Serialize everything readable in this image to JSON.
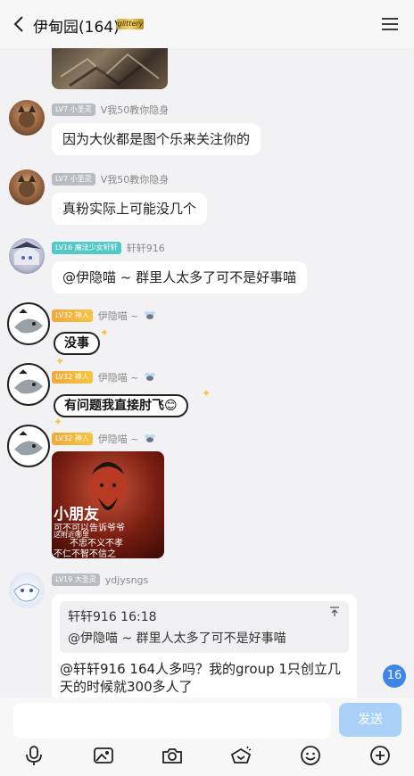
{
  "header": {
    "title": "伊甸园(164)",
    "badge": "glittery",
    "back_icon": "chevron-left-icon",
    "menu_icon": "hamburger-menu-icon"
  },
  "messages": [
    {
      "level": "LV7 小圣灵",
      "name": "V我50教你隐身",
      "text": "因为大伙都是图个乐来关注你的"
    },
    {
      "level": "LV7 小圣灵",
      "name": "V我50教你隐身",
      "text": "真粉实际上可能没几个"
    },
    {
      "level": "LV16 魔法少女轩轩",
      "name": "轩轩916",
      "text": "@伊隐喵 ~ 群里人太多了可不是好事喵"
    },
    {
      "level": "LV32 神人",
      "name": "伊隐喵 ~",
      "sticker_text": "没事"
    },
    {
      "level": "LV32 神人",
      "name": "伊隐喵 ~",
      "sticker_text": "有问题我直接肘飞😊"
    },
    {
      "level": "LV32 神人",
      "name": "伊隐喵 ~",
      "image_caption": "小朋友",
      "image_line2": "可不可以告诉爷爷",
      "image_line3": "这附近哪里",
      "image_line4": "不忠不义不孝",
      "image_line5": "不仁不智不信之"
    },
    {
      "level": "LV19 大圣灵",
      "name": "ydjysngs",
      "quote_header": "轩轩916 16:18",
      "quote_text": "@伊隐喵 ~ 群里人太多了可不是好事喵",
      "text": "@轩轩916 164人多吗？我的group 1只创立几天的时候就300多人了"
    }
  ],
  "unread_count": "16",
  "input": {
    "placeholder": "",
    "send_label": "发送"
  },
  "toolbar": [
    {
      "icon": "microphone-icon"
    },
    {
      "icon": "image-icon"
    },
    {
      "icon": "camera-icon"
    },
    {
      "icon": "red-packet-icon"
    },
    {
      "icon": "emoji-icon"
    },
    {
      "icon": "plus-icon"
    }
  ]
}
